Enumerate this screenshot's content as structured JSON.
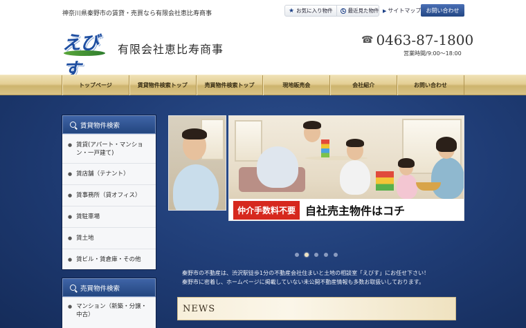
{
  "header": {
    "tagline": "神奈川県秦野市の賃貸・売買なら有限会社恵比寿商事",
    "favorites_label": "お気に入り物件",
    "recent_label": "最近見た物件",
    "sitemap_label": "サイトマップ",
    "contact_label": "お問い合わせ",
    "logo_text": "えびす",
    "company_name": "有限会社恵比寿商事",
    "phone": "0463-87-1800",
    "hours": "営業時間/9:00～18:00"
  },
  "nav": {
    "items": [
      {
        "label": "トップページ"
      },
      {
        "label": "賃貸物件検索トップ"
      },
      {
        "label": "売買物件検索トップ"
      },
      {
        "label": "現地販売会"
      },
      {
        "label": "会社紹介"
      },
      {
        "label": "お問い合わせ"
      }
    ]
  },
  "sidebar": {
    "rent_title": "賃貸物件検索",
    "rent_items": [
      {
        "label": "賃貸(アパート・マンション・一戸建て)"
      },
      {
        "label": "賃店舗（テナント）"
      },
      {
        "label": "賃事務所（貸オフィス）"
      },
      {
        "label": "賃駐車場"
      },
      {
        "label": "賃土地"
      },
      {
        "label": "賃ビル・賃倉庫・その他"
      }
    ],
    "sale_title": "売買物件検索",
    "sale_items": [
      {
        "label": "マンション（新築・分譲・中古）"
      }
    ]
  },
  "hero": {
    "badge_red": "仲介手数料不要",
    "badge_black": "自社売主物件はコチ",
    "slide_count": 5,
    "active_slide": 2
  },
  "intro": {
    "line1": "秦野市の不動産は、渋沢駅徒歩1分の不動産会社住まいと土地の相談室「えびす」にお任せ下さい！",
    "line2": "秦野市に密着し、ホームページに掲載していない未公開不動産情報も多数お取扱いしております。"
  },
  "news": {
    "title": "NEWS"
  },
  "colors": {
    "navy": "#1f3c75",
    "gold": "#e4cf94",
    "accent_blue": "#234784",
    "banner_red": "#d6281e"
  }
}
